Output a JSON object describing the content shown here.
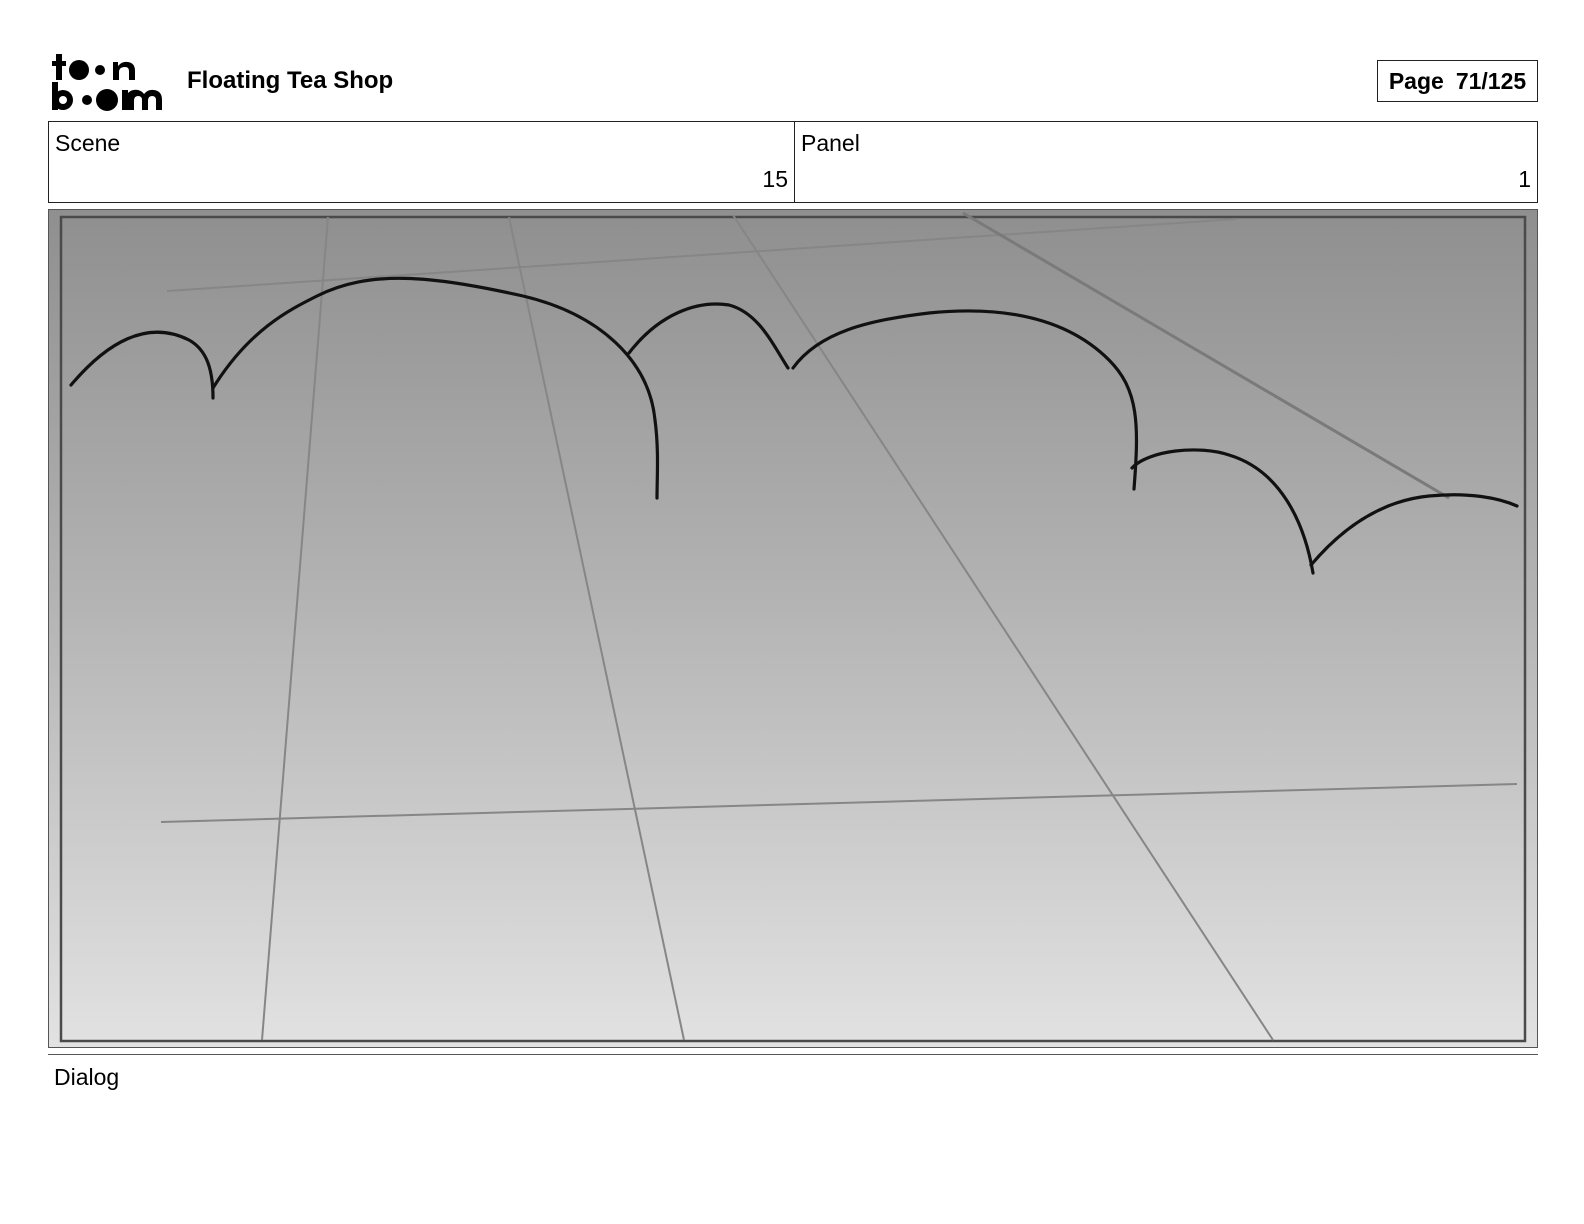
{
  "logo": {
    "line1": "toon",
    "line2": "boom"
  },
  "header": {
    "project_title": "Floating Tea Shop",
    "page_label": "Page",
    "page_number": "71/125"
  },
  "info": {
    "scene_label": "Scene",
    "scene_value": "15",
    "panel_label": "Panel",
    "panel_value": "1"
  },
  "dialog": {
    "label": "Dialog"
  }
}
